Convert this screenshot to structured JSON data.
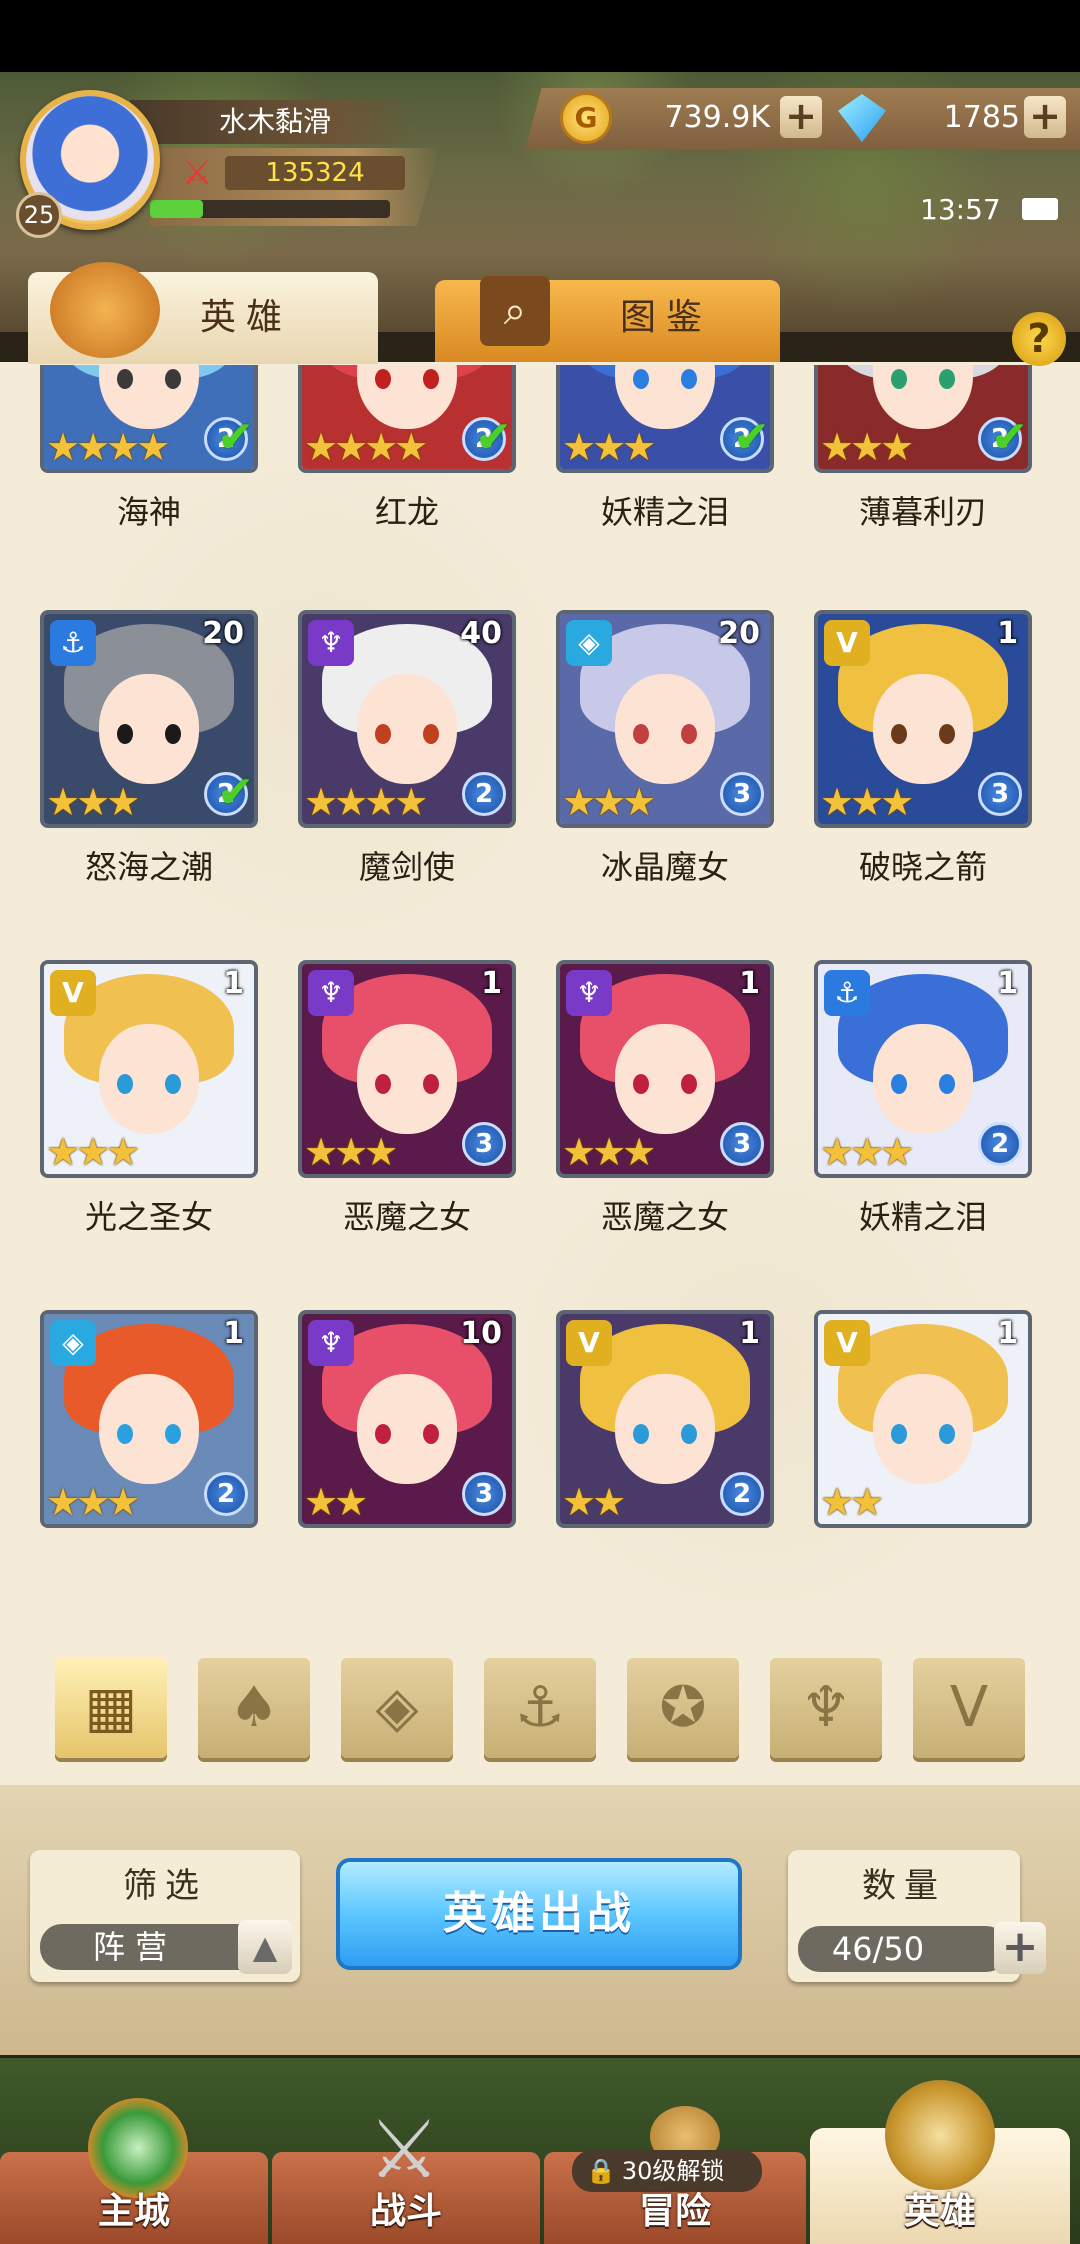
{
  "player": {
    "name": "水木黏滑",
    "level": "25",
    "power": "135324",
    "xp_fraction": 0.22
  },
  "resources": {
    "gold": "739.9K",
    "gems": "1785",
    "plus": "+"
  },
  "status": {
    "time": "13:57"
  },
  "tabs": {
    "heroes": "英雄",
    "codex": "图鉴",
    "help": "?"
  },
  "colors": {
    "accent": "#f0a93a",
    "deploy": "#3fb2ff",
    "check": "#49d12a",
    "star": "#f4c23a"
  },
  "heroes": [
    {
      "name": "海神",
      "level": "",
      "stars": "★★★★",
      "rank": "2",
      "check": "✔",
      "faction": "",
      "hair": "#7fc9ef",
      "bg": "#3f6fb8",
      "eye": "#3a3a3a"
    },
    {
      "name": "红龙",
      "level": "",
      "stars": "★★★★",
      "rank": "2",
      "check": "✔",
      "faction": "",
      "hair": "#e0424a",
      "bg": "#b83030",
      "eye": "#c02020"
    },
    {
      "name": "妖精之泪",
      "level": "",
      "stars": "★★★",
      "rank": "2",
      "check": "✔",
      "faction": "",
      "hair": "#3b6fd8",
      "bg": "#3a4fa8",
      "eye": "#2a80e0"
    },
    {
      "name": "薄暮利刃",
      "level": "",
      "stars": "★★★",
      "rank": "2",
      "check": "✔",
      "faction": "",
      "hair": "#d8d8e0",
      "bg": "#8a2a2a",
      "eye": "#2aa070"
    },
    {
      "name": "怒海之潮",
      "level": "20",
      "stars": "★★★",
      "rank": "2",
      "check": "✔",
      "faction": "⚓",
      "fcolor": "#2a7ae0",
      "hair": "#8a8f98",
      "bg": "#3a4a6a",
      "eye": "#1a1a1a"
    },
    {
      "name": "魔剑使",
      "level": "40",
      "stars": "★★★★",
      "rank": "2",
      "check": "",
      "faction": "♆",
      "fcolor": "#7a3ac8",
      "hair": "#eeeeee",
      "bg": "#4a3a6a",
      "eye": "#c04020"
    },
    {
      "name": "冰晶魔女",
      "level": "20",
      "stars": "★★★",
      "rank": "3",
      "check": "",
      "faction": "◈",
      "fcolor": "#2aa8e0",
      "hair": "#c8c8e8",
      "bg": "#5a6aa8",
      "eye": "#c04040"
    },
    {
      "name": "破晓之箭",
      "level": "1",
      "stars": "★★★",
      "rank": "3",
      "check": "",
      "faction": "V",
      "fcolor": "#e0b020",
      "hair": "#f0c040",
      "bg": "#2a4a9a",
      "eye": "#6a3a1a"
    },
    {
      "name": "光之圣女",
      "level": "1",
      "stars": "★★★",
      "rank": "",
      "check": "",
      "faction": "V",
      "fcolor": "#e0b020",
      "hair": "#f0c050",
      "bg": "#eef2f8",
      "eye": "#2a9ad8"
    },
    {
      "name": "恶魔之女",
      "level": "1",
      "stars": "★★★",
      "rank": "3",
      "check": "",
      "faction": "♆",
      "fcolor": "#7a3ac8",
      "hair": "#e8506a",
      "bg": "#5a1a4a",
      "eye": "#c02040"
    },
    {
      "name": "恶魔之女",
      "level": "1",
      "stars": "★★★",
      "rank": "3",
      "check": "",
      "faction": "♆",
      "fcolor": "#7a3ac8",
      "hair": "#e8506a",
      "bg": "#5a1a4a",
      "eye": "#c02040"
    },
    {
      "name": "妖精之泪",
      "level": "1",
      "stars": "★★★",
      "rank": "2",
      "check": "",
      "faction": "⚓",
      "fcolor": "#2a7ae0",
      "hair": "#3b6fd8",
      "bg": "#e8eaf8",
      "eye": "#2a80e0"
    },
    {
      "name": "",
      "level": "1",
      "stars": "★★★",
      "rank": "2",
      "check": "",
      "faction": "◈",
      "fcolor": "#2aa8e0",
      "hair": "#e85a2a",
      "bg": "#6a8ab8",
      "eye": "#2aa0e0"
    },
    {
      "name": "",
      "level": "10",
      "stars": "★★",
      "rank": "3",
      "check": "",
      "faction": "♆",
      "fcolor": "#7a3ac8",
      "hair": "#e8506a",
      "bg": "#5a1a4a",
      "eye": "#c02040"
    },
    {
      "name": "",
      "level": "1",
      "stars": "★★",
      "rank": "2",
      "check": "",
      "faction": "V",
      "fcolor": "#e0b020",
      "hair": "#f0c040",
      "bg": "#4a3a6a",
      "eye": "#2a9ad8"
    },
    {
      "name": "",
      "level": "1",
      "stars": "★★",
      "rank": "",
      "check": "",
      "faction": "V",
      "fcolor": "#e0b020",
      "hair": "#f0c050",
      "bg": "#eef2f8",
      "eye": "#2a9ad8"
    }
  ],
  "filter_icons": [
    {
      "icon": "all-grid-icon",
      "glyph": "▦"
    },
    {
      "icon": "forest-faction-icon",
      "glyph": "♠"
    },
    {
      "icon": "ice-faction-icon",
      "glyph": "◈"
    },
    {
      "icon": "anchor-faction-icon",
      "glyph": "⚓"
    },
    {
      "icon": "beast-faction-icon",
      "glyph": "✪"
    },
    {
      "icon": "demon-faction-icon",
      "glyph": "♆"
    },
    {
      "icon": "light-faction-icon",
      "glyph": "V"
    }
  ],
  "bottom": {
    "filter_label": "筛选",
    "faction_value": "阵营",
    "up_arrow": "▲",
    "deploy_label": "英雄出战",
    "count_label": "数量",
    "count_value": "46/50",
    "plus": "+"
  },
  "nav": {
    "city": "主城",
    "battle": "战斗",
    "adventure": "冒险",
    "heroes": "英雄",
    "lock_text": "30级解锁"
  }
}
